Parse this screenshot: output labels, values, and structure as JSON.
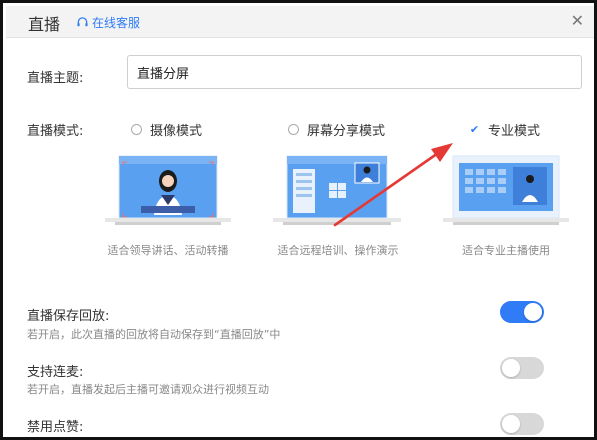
{
  "window": {
    "title": "直播",
    "service_link": "在线客服"
  },
  "form": {
    "topic_label": "直播主题:",
    "topic_value": "直播分屏",
    "mode_label": "直播模式:"
  },
  "modes": [
    {
      "label": "摄像模式",
      "caption": "适合领导讲话、活动转播",
      "selected": false
    },
    {
      "label": "屏幕分享模式",
      "caption": "适合远程培训、操作演示",
      "selected": false
    },
    {
      "label": "专业模式",
      "caption": "适合专业主播使用",
      "selected": true
    }
  ],
  "settings": [
    {
      "title": "直播保存回放:",
      "desc": "若开启，此次直播的回放将自动保存到“直播回放”中",
      "enabled": true
    },
    {
      "title": "支持连麦:",
      "desc": "若开启，直播发起后主播可邀请观众进行视频互动",
      "enabled": false
    },
    {
      "title": "禁用点赞:",
      "desc": "",
      "enabled": false
    }
  ],
  "colors": {
    "accent": "#2f7cf6",
    "arrow": "#e53935"
  },
  "icons": {
    "service": "headset-icon",
    "close": "close-icon",
    "radio_selected": "check-icon"
  }
}
